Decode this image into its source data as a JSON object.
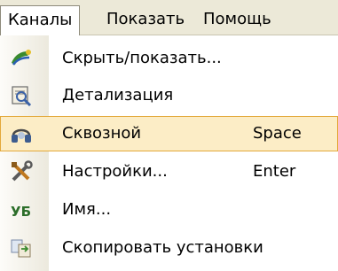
{
  "menubar": {
    "items": [
      {
        "label": "Каналы",
        "active": true
      },
      {
        "label": "Показать",
        "active": false
      },
      {
        "label": "Помощь",
        "active": false
      }
    ]
  },
  "menu": {
    "items": [
      {
        "label": "Скрыть/показать...",
        "shortcut": "",
        "icon": "hide-show-icon"
      },
      {
        "label": "Детализация",
        "shortcut": "",
        "icon": "details-icon"
      },
      {
        "label": "Сквозной",
        "shortcut": "Space",
        "icon": "headphones-icon",
        "highlighted": true
      },
      {
        "label": "Настройки...",
        "shortcut": "Enter",
        "icon": "tools-icon"
      },
      {
        "label": "Имя...",
        "shortcut": "",
        "icon": "name-icon"
      },
      {
        "label": "Скопировать установки",
        "shortcut": "",
        "icon": "copy-settings-icon"
      }
    ]
  },
  "colors": {
    "menubar_bg": "#ece9d8",
    "highlight_bg": "#fcedc6",
    "highlight_border": "#e3a93b"
  }
}
